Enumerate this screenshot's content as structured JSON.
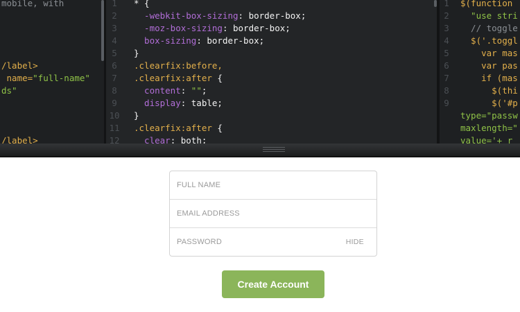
{
  "editor": {
    "html_pane": {
      "lines": [
        [
          {
            "t": "mobile, with",
            "c": "c-comment"
          }
        ],
        [],
        [],
        [],
        [],
        [
          {
            "t": "/label>",
            "c": "c-tag"
          }
        ],
        [
          {
            "t": " name=",
            "c": "c-tag"
          },
          {
            "t": "\"full-name\"",
            "c": "c-str"
          }
        ],
        [
          {
            "t": "ds\"",
            "c": "c-str"
          }
        ],
        [],
        [],
        [],
        [
          {
            "t": "/label>",
            "c": "c-tag"
          }
        ]
      ]
    },
    "css_pane": {
      "line_numbers": [
        "1",
        "2",
        "3",
        "4",
        "5",
        "6",
        "7",
        "8",
        "9",
        "10",
        "11",
        "12"
      ],
      "lines": [
        [
          {
            "t": "* {",
            "c": "c-plain"
          }
        ],
        [
          {
            "t": "  -webkit-box-sizing",
            "c": "c-prop"
          },
          {
            "t": ": border-box;",
            "c": "c-plain"
          }
        ],
        [
          {
            "t": "  -moz-box-sizing",
            "c": "c-prop"
          },
          {
            "t": ": border-box;",
            "c": "c-plain"
          }
        ],
        [
          {
            "t": "  box-sizing",
            "c": "c-prop"
          },
          {
            "t": ": border-box;",
            "c": "c-plain"
          }
        ],
        [
          {
            "t": "}",
            "c": "c-plain"
          }
        ],
        [
          {
            "t": ".clearfix:before,",
            "c": "c-sel"
          }
        ],
        [
          {
            "t": ".clearfix:after",
            "c": "c-sel"
          },
          {
            "t": " {",
            "c": "c-plain"
          }
        ],
        [
          {
            "t": "  content",
            "c": "c-prop"
          },
          {
            "t": ": ",
            "c": "c-plain"
          },
          {
            "t": "\"\"",
            "c": "c-str"
          },
          {
            "t": ";",
            "c": "c-plain"
          }
        ],
        [
          {
            "t": "  display",
            "c": "c-prop"
          },
          {
            "t": ": table;",
            "c": "c-plain"
          }
        ],
        [
          {
            "t": "}",
            "c": "c-plain"
          }
        ],
        [
          {
            "t": ".clearfix:after",
            "c": "c-sel"
          },
          {
            "t": " {",
            "c": "c-plain"
          }
        ],
        [
          {
            "t": "  clear",
            "c": "c-prop"
          },
          {
            "t": ": both;",
            "c": "c-plain"
          }
        ]
      ]
    },
    "js_pane": {
      "line_numbers": [
        "1",
        "2",
        "3",
        "4",
        "5",
        "6",
        "7",
        "8",
        "9",
        "",
        "",
        "",
        ""
      ],
      "lines": [
        [
          {
            "t": "$(function",
            "c": "c-tag"
          }
        ],
        [
          {
            "t": "  \"use stri",
            "c": "c-str"
          }
        ],
        [
          {
            "t": "  // toggle",
            "c": "c-comment"
          }
        ],
        [
          {
            "t": "  $('.toggl",
            "c": "c-tag"
          }
        ],
        [
          {
            "t": "    var mas",
            "c": "c-tag"
          }
        ],
        [
          {
            "t": "    var pas",
            "c": "c-tag"
          }
        ],
        [
          {
            "t": "    if (mas",
            "c": "c-tag"
          }
        ],
        [
          {
            "t": "      $(thi",
            "c": "c-tag"
          }
        ],
        [
          {
            "t": "      $('#p",
            "c": "c-tag"
          }
        ],
        [
          {
            "t": "type=\"passw",
            "c": "c-str"
          }
        ],
        [
          {
            "t": "maxlength=\"",
            "c": "c-str"
          }
        ],
        [
          {
            "t": "value='+ r",
            "c": "c-str"
          }
        ]
      ]
    }
  },
  "form": {
    "full_name_placeholder": "FULL NAME",
    "email_placeholder": "EMAIL ADDRESS",
    "password_placeholder": "PASSWORD",
    "hide_label": "HIDE",
    "submit_label": "Create Account"
  },
  "colors": {
    "button": "#8bb55a",
    "editor_bg": "#1d1f21"
  }
}
